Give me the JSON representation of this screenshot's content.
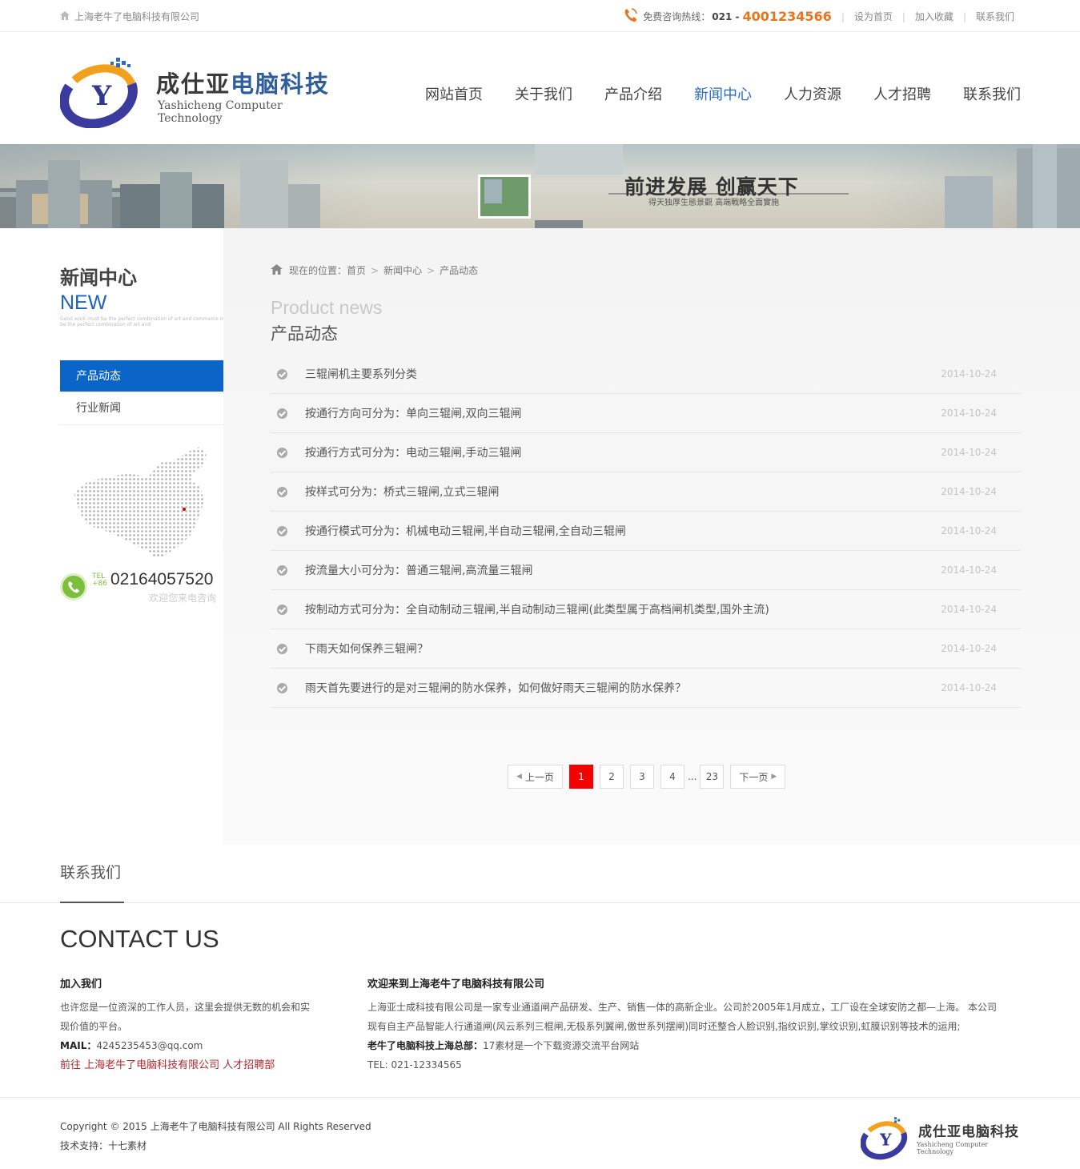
{
  "topbar": {
    "company": "上海老牛了电脑科技有限公司",
    "hotline_label": "免费咨询热线：",
    "hotline_area": "021 -",
    "hotline_number": "4001234566",
    "links": [
      "设为首页",
      "加入收藏",
      "联系我们"
    ]
  },
  "header": {
    "logo_cn_dark": "成仕亚",
    "logo_cn_blue": "电脑科技",
    "logo_en": "Yashicheng Computer Technology",
    "nav": [
      "网站首页",
      "关于我们",
      "产品介绍",
      "新闻中心",
      "人力资源",
      "人才招聘",
      "联系我们"
    ],
    "nav_active_index": 3
  },
  "banner": {
    "slogan": "前进发展  创赢天下",
    "sub": "得天独厚生態景觀  高端戰略全面實施"
  },
  "sidebar": {
    "title_cn": "新闻中心",
    "title_en": "NEW",
    "title_small": "Good work must be the perfect combination of art and commerce must be the perfect combination of art and",
    "menu": [
      "产品动态",
      "行业新闻"
    ],
    "menu_active_index": 0,
    "tel_label_top": "TEL",
    "tel_label_bottom": "+86",
    "tel_number": "02164057520",
    "tel_welcome": "欢迎您来电咨询"
  },
  "content": {
    "breadcrumb": {
      "prefix": "现在的位置：",
      "items": [
        "首页",
        "新闻中心",
        "产品动态"
      ]
    },
    "section_en": "Product news",
    "section_cn": "产品动态",
    "news": [
      {
        "title": "三辊闸机主要系列分类",
        "date": "2014-10-24"
      },
      {
        "title": "按通行方向可分为：单向三辊闸,双向三辊闸",
        "date": "2014-10-24"
      },
      {
        "title": "按通行方式可分为：电动三辊闸,手动三辊闸",
        "date": "2014-10-24"
      },
      {
        "title": "按样式可分为：桥式三辊闸,立式三辊闸",
        "date": "2014-10-24"
      },
      {
        "title": "按通行模式可分为：机械电动三辊闸,半自动三辊闸,全自动三辊闸",
        "date": "2014-10-24"
      },
      {
        "title": "按流量大小可分为：普通三辊闸,高流量三辊闸",
        "date": "2014-10-24"
      },
      {
        "title": "按制动方式可分为：全自动制动三辊闸,半自动制动三辊闸(此类型属于高档闸机类型,国外主流)",
        "date": "2014-10-24"
      },
      {
        "title": "下雨天如何保养三辊闸？",
        "date": "2014-10-24"
      },
      {
        "title": "雨天首先要进行的是对三辊闸的防水保养，如何做好雨天三辊闸的防水保养？",
        "date": "2014-10-24"
      }
    ],
    "pager": {
      "prev": "上一页",
      "pages": [
        "1",
        "2",
        "3",
        "4"
      ],
      "dots": "...",
      "last": "23",
      "next": "下一页",
      "current": "1"
    }
  },
  "contact": {
    "heading": "联系我们",
    "big": "CONTACT US",
    "join_title": "加入我们",
    "join_text": "也许您是一位资深的工作人员，这里会提供无数的机会和实现价值的平台。",
    "mail_label": "MAIL：",
    "mail": "4245235453@qq.com",
    "join_link": "前往 上海老牛了电脑科技有限公司 人才招聘部",
    "welcome_title": "欢迎来到上海老牛了电脑科技有限公司",
    "welcome_text": "上海亚士成科技有限公司是一家专业通道闸产品研发、生产、销售一体的高新企业。公司於2005年1月成立，工厂设在全球安防之都—上海。 本公司现有自主产品智能人行通道闸(风云系列三棍闸,无极系列翼闸,傲世系列摆闸)同时还整合人脸识别,指纹识别,掌纹识别,虹膜识别等技术的运用;",
    "hq_label": "老牛了电脑科技上海总部：",
    "hq_text": "17素材是一个下载资源交流平台网站",
    "tel": "TEL: 021-12334565"
  },
  "footer": {
    "copyright": "Copyright © 2015 上海老牛了电脑科技有限公司 All Rights Reserved",
    "support": "技术支持：十七素材",
    "logo_cn_dark": "成仕亚",
    "logo_cn_blue": "电脑科技",
    "logo_en": "Yashicheng Computer Technology"
  },
  "colors": {
    "accent_blue": "#0b64c8",
    "nav_active": "#2a6cc6",
    "hotline_orange": "#e8751c",
    "pager_current": "#f40000",
    "link_red": "#b8272d"
  }
}
